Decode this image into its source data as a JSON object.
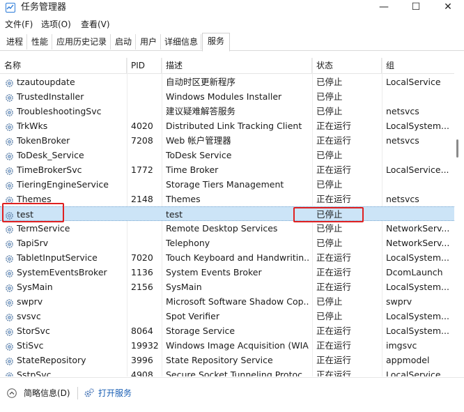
{
  "window": {
    "title": "任务管理器",
    "controls": {
      "minimize": "—",
      "maximize": "☐",
      "close": "✕"
    }
  },
  "menu": [
    "文件(F)",
    "选项(O)",
    "查看(V)"
  ],
  "tabs": [
    "进程",
    "性能",
    "应用历史记录",
    "启动",
    "用户",
    "详细信息",
    "服务"
  ],
  "active_tab": "服务",
  "columns": {
    "name": "名称",
    "pid": "PID",
    "desc": "描述",
    "status": "状态",
    "group": "组"
  },
  "rows": [
    {
      "name": "tzautoupdate",
      "pid": "",
      "desc": "自动时区更新程序",
      "status": "已停止",
      "group": "LocalService"
    },
    {
      "name": "TrustedInstaller",
      "pid": "",
      "desc": "Windows Modules Installer",
      "status": "已停止",
      "group": ""
    },
    {
      "name": "TroubleshootingSvc",
      "pid": "",
      "desc": "建议疑难解答服务",
      "status": "已停止",
      "group": "netsvcs"
    },
    {
      "name": "TrkWks",
      "pid": "4020",
      "desc": "Distributed Link Tracking Client",
      "status": "正在运行",
      "group": "LocalSystem..."
    },
    {
      "name": "TokenBroker",
      "pid": "7208",
      "desc": "Web 帐户管理器",
      "status": "正在运行",
      "group": "netsvcs"
    },
    {
      "name": "ToDesk_Service",
      "pid": "",
      "desc": "ToDesk Service",
      "status": "已停止",
      "group": ""
    },
    {
      "name": "TimeBrokerSvc",
      "pid": "1772",
      "desc": "Time Broker",
      "status": "正在运行",
      "group": "LocalService..."
    },
    {
      "name": "TieringEngineService",
      "pid": "",
      "desc": "Storage Tiers Management",
      "status": "已停止",
      "group": ""
    },
    {
      "name": "Themes",
      "pid": "2148",
      "desc": "Themes",
      "status": "正在运行",
      "group": "netsvcs"
    },
    {
      "name": "test",
      "pid": "",
      "desc": "test",
      "status": "已停止",
      "group": ""
    },
    {
      "name": "TermService",
      "pid": "",
      "desc": "Remote Desktop Services",
      "status": "已停止",
      "group": "NetworkServ..."
    },
    {
      "name": "TapiSrv",
      "pid": "",
      "desc": "Telephony",
      "status": "已停止",
      "group": "NetworkServ..."
    },
    {
      "name": "TabletInputService",
      "pid": "7020",
      "desc": "Touch Keyboard and Handwritin...",
      "status": "正在运行",
      "group": "LocalSystem..."
    },
    {
      "name": "SystemEventsBroker",
      "pid": "1136",
      "desc": "System Events Broker",
      "status": "正在运行",
      "group": "DcomLaunch"
    },
    {
      "name": "SysMain",
      "pid": "2156",
      "desc": "SysMain",
      "status": "正在运行",
      "group": "LocalSystem..."
    },
    {
      "name": "swprv",
      "pid": "",
      "desc": "Microsoft Software Shadow Cop...",
      "status": "已停止",
      "group": "swprv"
    },
    {
      "name": "svsvc",
      "pid": "",
      "desc": "Spot Verifier",
      "status": "已停止",
      "group": "LocalSystem..."
    },
    {
      "name": "StorSvc",
      "pid": "8064",
      "desc": "Storage Service",
      "status": "正在运行",
      "group": "LocalSystem..."
    },
    {
      "name": "StiSvc",
      "pid": "19932",
      "desc": "Windows Image Acquisition (WIA)",
      "status": "正在运行",
      "group": "imgsvc"
    },
    {
      "name": "StateRepository",
      "pid": "3996",
      "desc": "State Repository Service",
      "status": "正在运行",
      "group": "appmodel"
    },
    {
      "name": "SstpSvc",
      "pid": "4908",
      "desc": "Secure Socket Tunneling Protoc...",
      "status": "正在运行",
      "group": "LocalService..."
    }
  ],
  "selected_row": "test",
  "footer": {
    "less_details": "简略信息(D)",
    "open_services": "打开服务"
  },
  "colors": {
    "selected_bg": "#cce4f7",
    "highlight_box": "#e02020",
    "link": "#1a5fb4"
  }
}
